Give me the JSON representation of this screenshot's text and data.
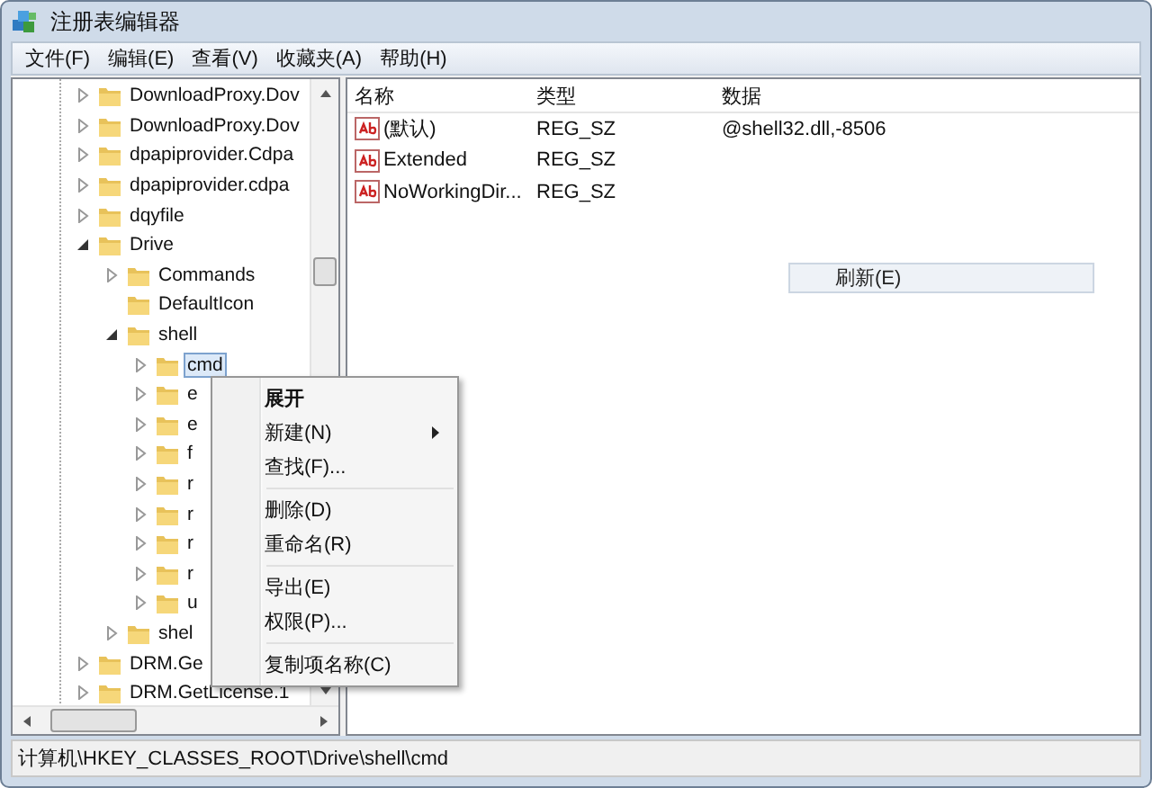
{
  "window": {
    "title": "注册表编辑器"
  },
  "menu_bar": [
    "文件(F)",
    "编辑(E)",
    "查看(V)",
    "收藏夹(A)",
    "帮助(H)"
  ],
  "tree": [
    {
      "label": "DownloadProxy.Dov",
      "kind": "node",
      "expanded": false,
      "selected": false
    },
    {
      "label": "DownloadProxy.Dov",
      "kind": "node",
      "expanded": false,
      "selected": false
    },
    {
      "label": "dpapiprovider.Cdpa",
      "kind": "node",
      "expanded": false,
      "selected": false
    },
    {
      "label": "dpapiprovider.cdpa",
      "kind": "node",
      "expanded": false,
      "selected": false
    },
    {
      "label": "dqyfile",
      "kind": "node",
      "expanded": false,
      "selected": false
    },
    {
      "label": "Drive",
      "kind": "node",
      "expanded": true,
      "selected": false,
      "children": [
        {
          "label": "Commands",
          "kind": "node",
          "expanded": false,
          "selected": false
        },
        {
          "label": "DefaultIcon",
          "kind": "leaf",
          "selected": false
        },
        {
          "label": "shell",
          "kind": "node",
          "expanded": true,
          "selected": false,
          "children": [
            {
              "label": "cmd",
              "kind": "node",
              "expanded": false,
              "selected": true
            },
            {
              "label": "e",
              "kind": "node",
              "expanded": false,
              "selected": false
            },
            {
              "label": "e",
              "kind": "node",
              "expanded": false,
              "selected": false
            },
            {
              "label": "f",
              "kind": "node",
              "expanded": false,
              "selected": false
            },
            {
              "label": "r",
              "kind": "node",
              "expanded": false,
              "selected": false
            },
            {
              "label": "r",
              "kind": "node",
              "expanded": false,
              "selected": false
            },
            {
              "label": "r",
              "kind": "node",
              "expanded": false,
              "selected": false
            },
            {
              "label": "r",
              "kind": "node",
              "expanded": false,
              "selected": false
            },
            {
              "label": "u",
              "kind": "node",
              "expanded": false,
              "selected": false
            }
          ]
        },
        {
          "label": "shel",
          "kind": "node",
          "expanded": false,
          "selected": false
        }
      ]
    },
    {
      "label": "DRM.Ge",
      "kind": "node",
      "expanded": false,
      "selected": false
    },
    {
      "label": "DRM.GetLicense.1",
      "kind": "node",
      "expanded": false,
      "selected": false
    }
  ],
  "table": {
    "columns": [
      "名称",
      "类型",
      "数据"
    ],
    "rows": [
      {
        "name": "(默认)",
        "type": "REG_SZ",
        "data": "@shell32.dll,-8506"
      },
      {
        "name": "Extended",
        "type": "REG_SZ"
      },
      {
        "name": "NoWorkingDir...",
        "type": "REG_SZ"
      }
    ]
  },
  "popup_item": "刷新(E)",
  "context_menu": [
    [
      {
        "label": "展开",
        "default": true,
        "submenu": false
      },
      {
        "label": "新建(N)",
        "default": false,
        "submenu": true
      },
      {
        "label": "查找(F)...",
        "default": false,
        "submenu": false
      }
    ],
    [
      {
        "label": "删除(D)",
        "default": false,
        "submenu": false
      },
      {
        "label": "重命名(R)",
        "default": false,
        "submenu": false
      }
    ],
    [
      {
        "label": "导出(E)",
        "default": false,
        "submenu": false
      },
      {
        "label": "权限(P)...",
        "default": false,
        "submenu": false
      }
    ],
    [
      {
        "label": "复制项名称(C)",
        "default": false,
        "submenu": false
      }
    ]
  ],
  "status_bar": "计算机\\HKEY_CLASSES_ROOT\\Drive\\shell\\cmd"
}
